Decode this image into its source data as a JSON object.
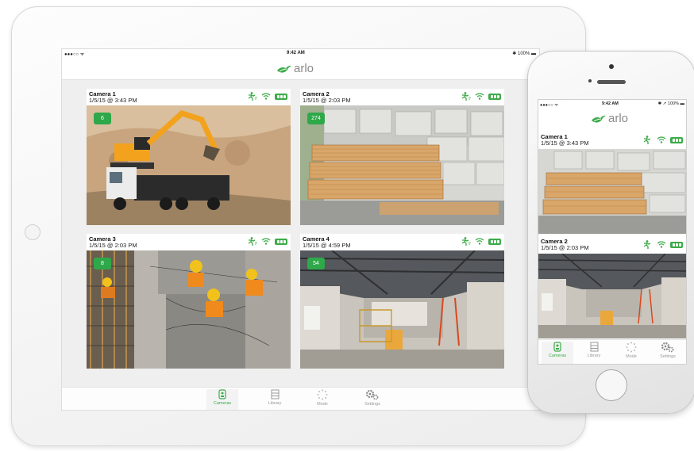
{
  "colors": {
    "accent": "#3cab48",
    "badge": "#2fa84a"
  },
  "ipad": {
    "status_left": "●●●○○ ᯤ",
    "status_time": "9:42 AM",
    "status_right": "✱ 100% ▬",
    "logo_text": "arlo",
    "cameras": [
      {
        "name": "Camera 1",
        "timestamp": "1/5/15 @ 3:43 PM",
        "badge": "6",
        "scene": "excavator-truck"
      },
      {
        "name": "Camera 2",
        "timestamp": "1/5/15 @ 2:03 PM",
        "badge": "274",
        "scene": "lumber-yard"
      },
      {
        "name": "Camera 3",
        "timestamp": "1/5/15 @ 2:03 PM",
        "badge": "8",
        "scene": "workers-overhead"
      },
      {
        "name": "Camera 4",
        "timestamp": "1/5/15 @ 4:59 PM",
        "badge": "54",
        "scene": "interior-construction"
      }
    ],
    "tabs": [
      {
        "label": "Cameras",
        "icon": "camera-icon",
        "active": true
      },
      {
        "label": "Library",
        "icon": "library-icon",
        "active": false
      },
      {
        "label": "Mode",
        "icon": "mode-icon",
        "active": false
      },
      {
        "label": "Settings",
        "icon": "gears-icon",
        "active": false
      }
    ]
  },
  "iphone": {
    "status_left": "●●●○○ ᯤ",
    "status_time": "9:42 AM",
    "status_right": "✱ ➚ 100% ▬",
    "logo_text": "arlo",
    "cameras": [
      {
        "name": "Camera 1",
        "timestamp": "1/5/15 @ 3:43 PM",
        "scene": "lumber-yard"
      },
      {
        "name": "Camera 2",
        "timestamp": "1/5/15 @ 2:03 PM",
        "scene": "interior-construction"
      }
    ],
    "tabs": [
      {
        "label": "Cameras",
        "icon": "camera-icon",
        "active": true
      },
      {
        "label": "Library",
        "icon": "library-icon",
        "active": false
      },
      {
        "label": "Mode",
        "icon": "mode-icon",
        "active": false
      },
      {
        "label": "Settings",
        "icon": "gears-icon",
        "active": false
      }
    ]
  }
}
